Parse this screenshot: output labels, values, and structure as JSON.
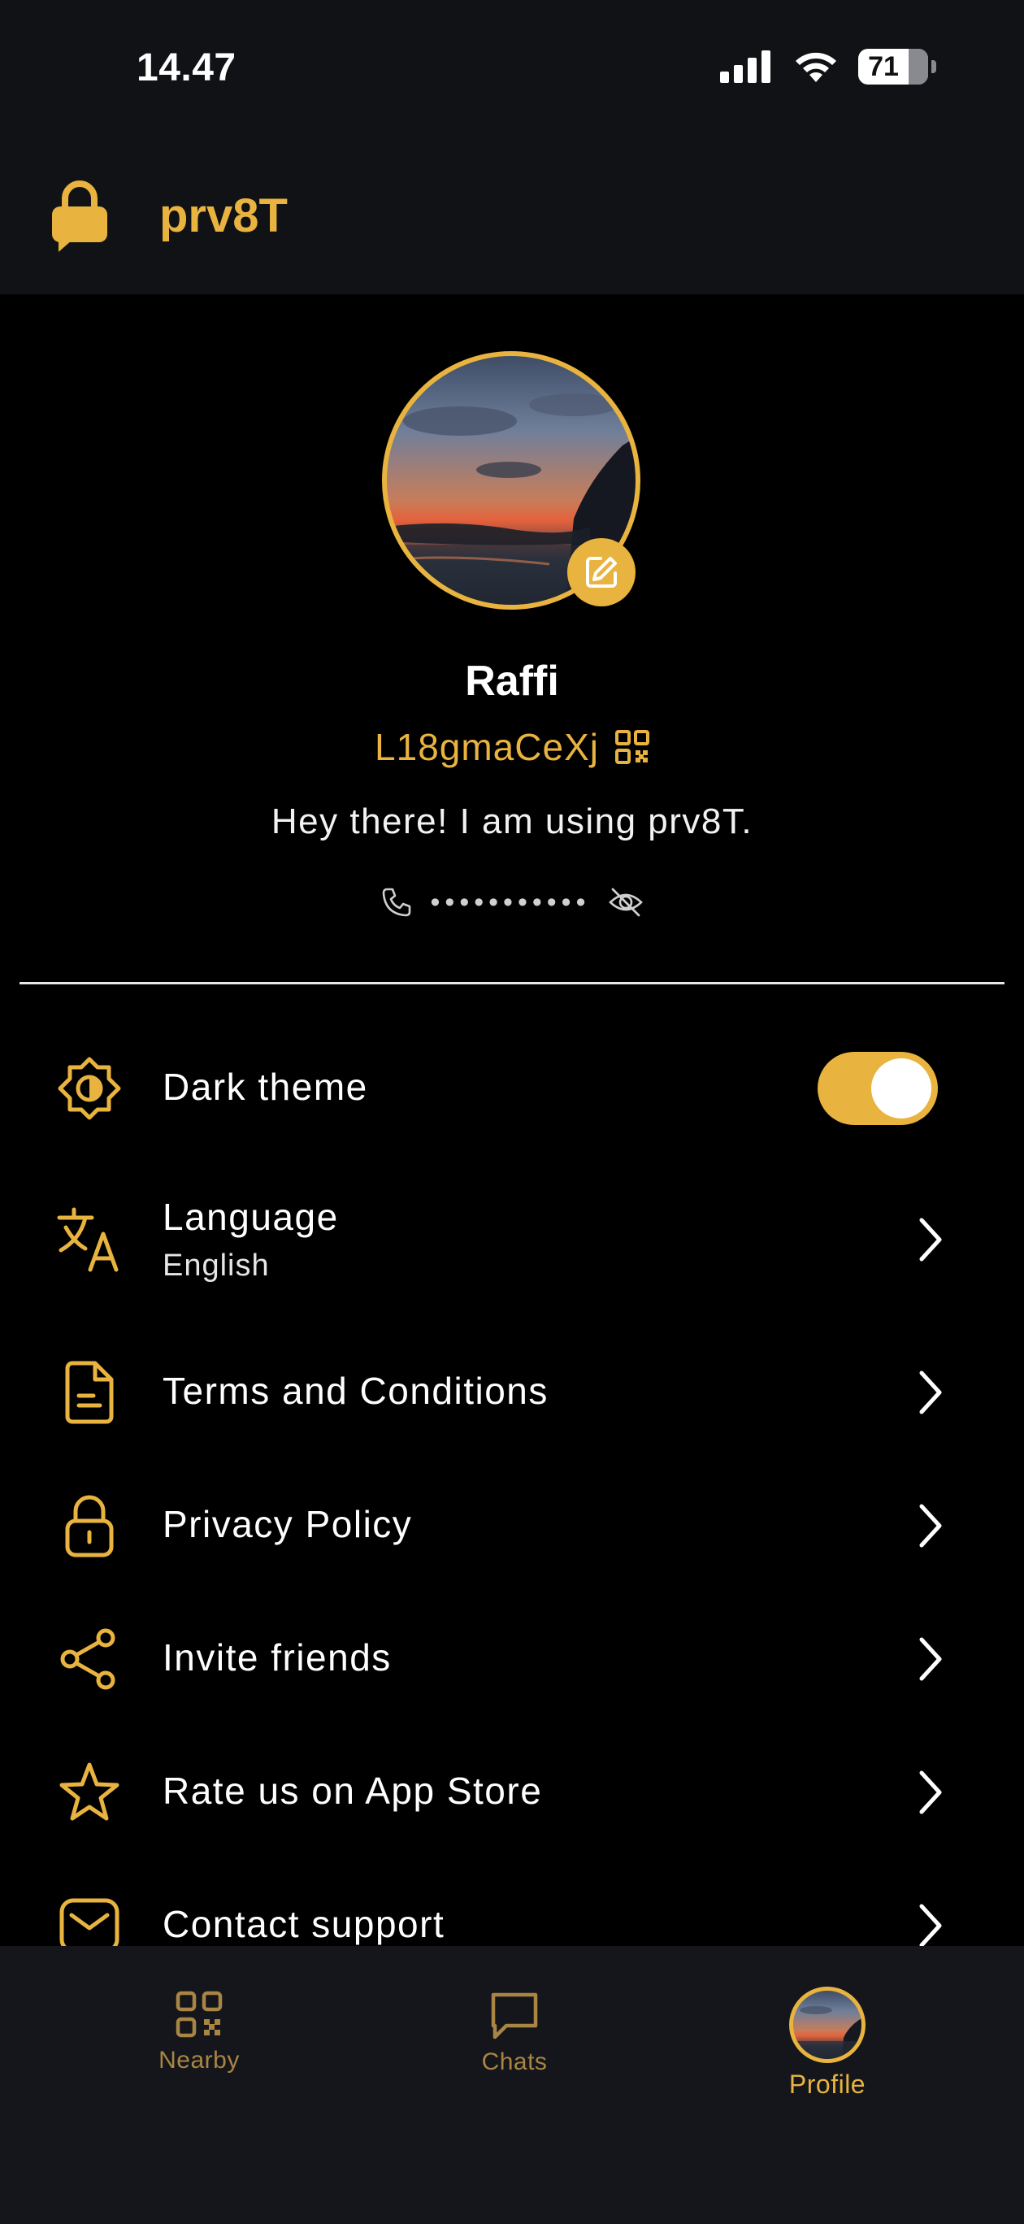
{
  "status_bar": {
    "time": "14.47",
    "battery": "71"
  },
  "app": {
    "title": "prv8T",
    "accent": "#e8b33e"
  },
  "profile": {
    "name": "Raffi",
    "id": "L18gmaCeXj",
    "status": "Hey there! I am using prv8T.",
    "phone_masked": "•••••••••••"
  },
  "settings": {
    "dark_theme": {
      "label": "Dark theme",
      "enabled": true
    },
    "language": {
      "label": "Language",
      "value": "English"
    },
    "terms": {
      "label": "Terms and Conditions"
    },
    "privacy": {
      "label": "Privacy Policy"
    },
    "invite": {
      "label": "Invite friends"
    },
    "rate": {
      "label": "Rate us on App Store"
    },
    "support": {
      "label": "Contact support"
    }
  },
  "bottom_nav": {
    "nearby": "Nearby",
    "chats": "Chats",
    "profile": "Profile",
    "active": "profile"
  },
  "icons": {
    "signal": "signal-icon",
    "wifi": "wifi-icon",
    "battery": "battery-icon",
    "logo": "lock-chat-logo-icon",
    "edit": "edit-icon",
    "qr": "qr-code-icon",
    "phone": "phone-icon",
    "eye_off": "eye-off-icon",
    "theme": "theme-icon",
    "translate": "translate-icon",
    "document": "document-icon",
    "lock": "lock-icon",
    "share": "share-icon",
    "star": "star-icon",
    "mail": "mail-icon",
    "chevron": "chevron-right-icon",
    "chat": "chat-bubble-icon"
  }
}
